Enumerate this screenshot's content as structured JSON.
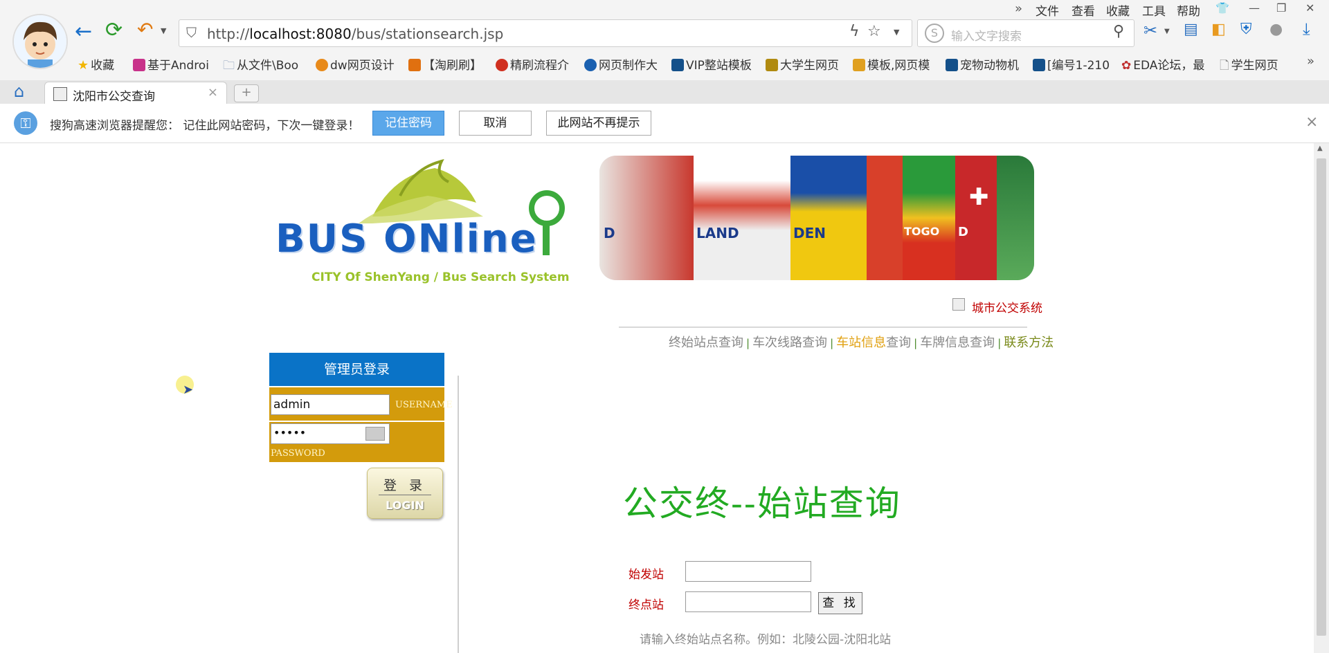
{
  "browser": {
    "menu": [
      "文件",
      "查看",
      "收藏",
      "工具",
      "帮助"
    ],
    "url_prefix": "http://",
    "url_host": "localhost:8080",
    "url_path": "/bus/stationsearch.jsp",
    "search_placeholder": "输入文字搜索",
    "bookmarks": [
      "收藏",
      "基于Androi",
      "从文件\\Boo",
      "dw网页设计",
      "【淘刷刷】",
      "精刷流程介",
      "网页制作大",
      "VIP整站模板",
      "大学生网页",
      "模板,网页模",
      "宠物动物机",
      "[编号1-210",
      "EDA论坛，最",
      "学生网页"
    ],
    "tab_title": "沈阳市公交查询",
    "tab_close": "×",
    "new_tab": "+"
  },
  "notify": {
    "message": "搜狗高速浏览器提醒您： 记住此网站密码，下次一键登录！",
    "remember_btn": "记住密码",
    "cancel_btn": "取消",
    "never_btn": "此网站不再提示",
    "close": "×"
  },
  "site": {
    "logo_text": "BUS ONline",
    "logo_subtitle": "CITY Of ShenYang / Bus Search System",
    "banner_labels": [
      "D",
      "LAND",
      "DEN",
      "TOGO",
      "D"
    ],
    "system_link": "城市公交系统",
    "nav": [
      {
        "label": "终始站点查询"
      },
      {
        "label": "车次线路查询"
      },
      {
        "label_highlight": "车站信息",
        "label_rest": "查询"
      },
      {
        "label": "车牌信息查询"
      },
      {
        "label": "联系方法"
      }
    ],
    "nav_sep": "|"
  },
  "login": {
    "title": "管理员登录",
    "username_value": "admin",
    "username_label": "USERNAME",
    "password_value": "•••••",
    "password_label": "PASSWORD",
    "button_cn": "登 录",
    "button_en": "LOGIN"
  },
  "search": {
    "title": "公交终--始站查询",
    "start_label": "始发站",
    "end_label": "终点站",
    "find_btn": "查 找",
    "hint": "请输入终始站点名称。例如：北陵公园-沈阳北站"
  }
}
